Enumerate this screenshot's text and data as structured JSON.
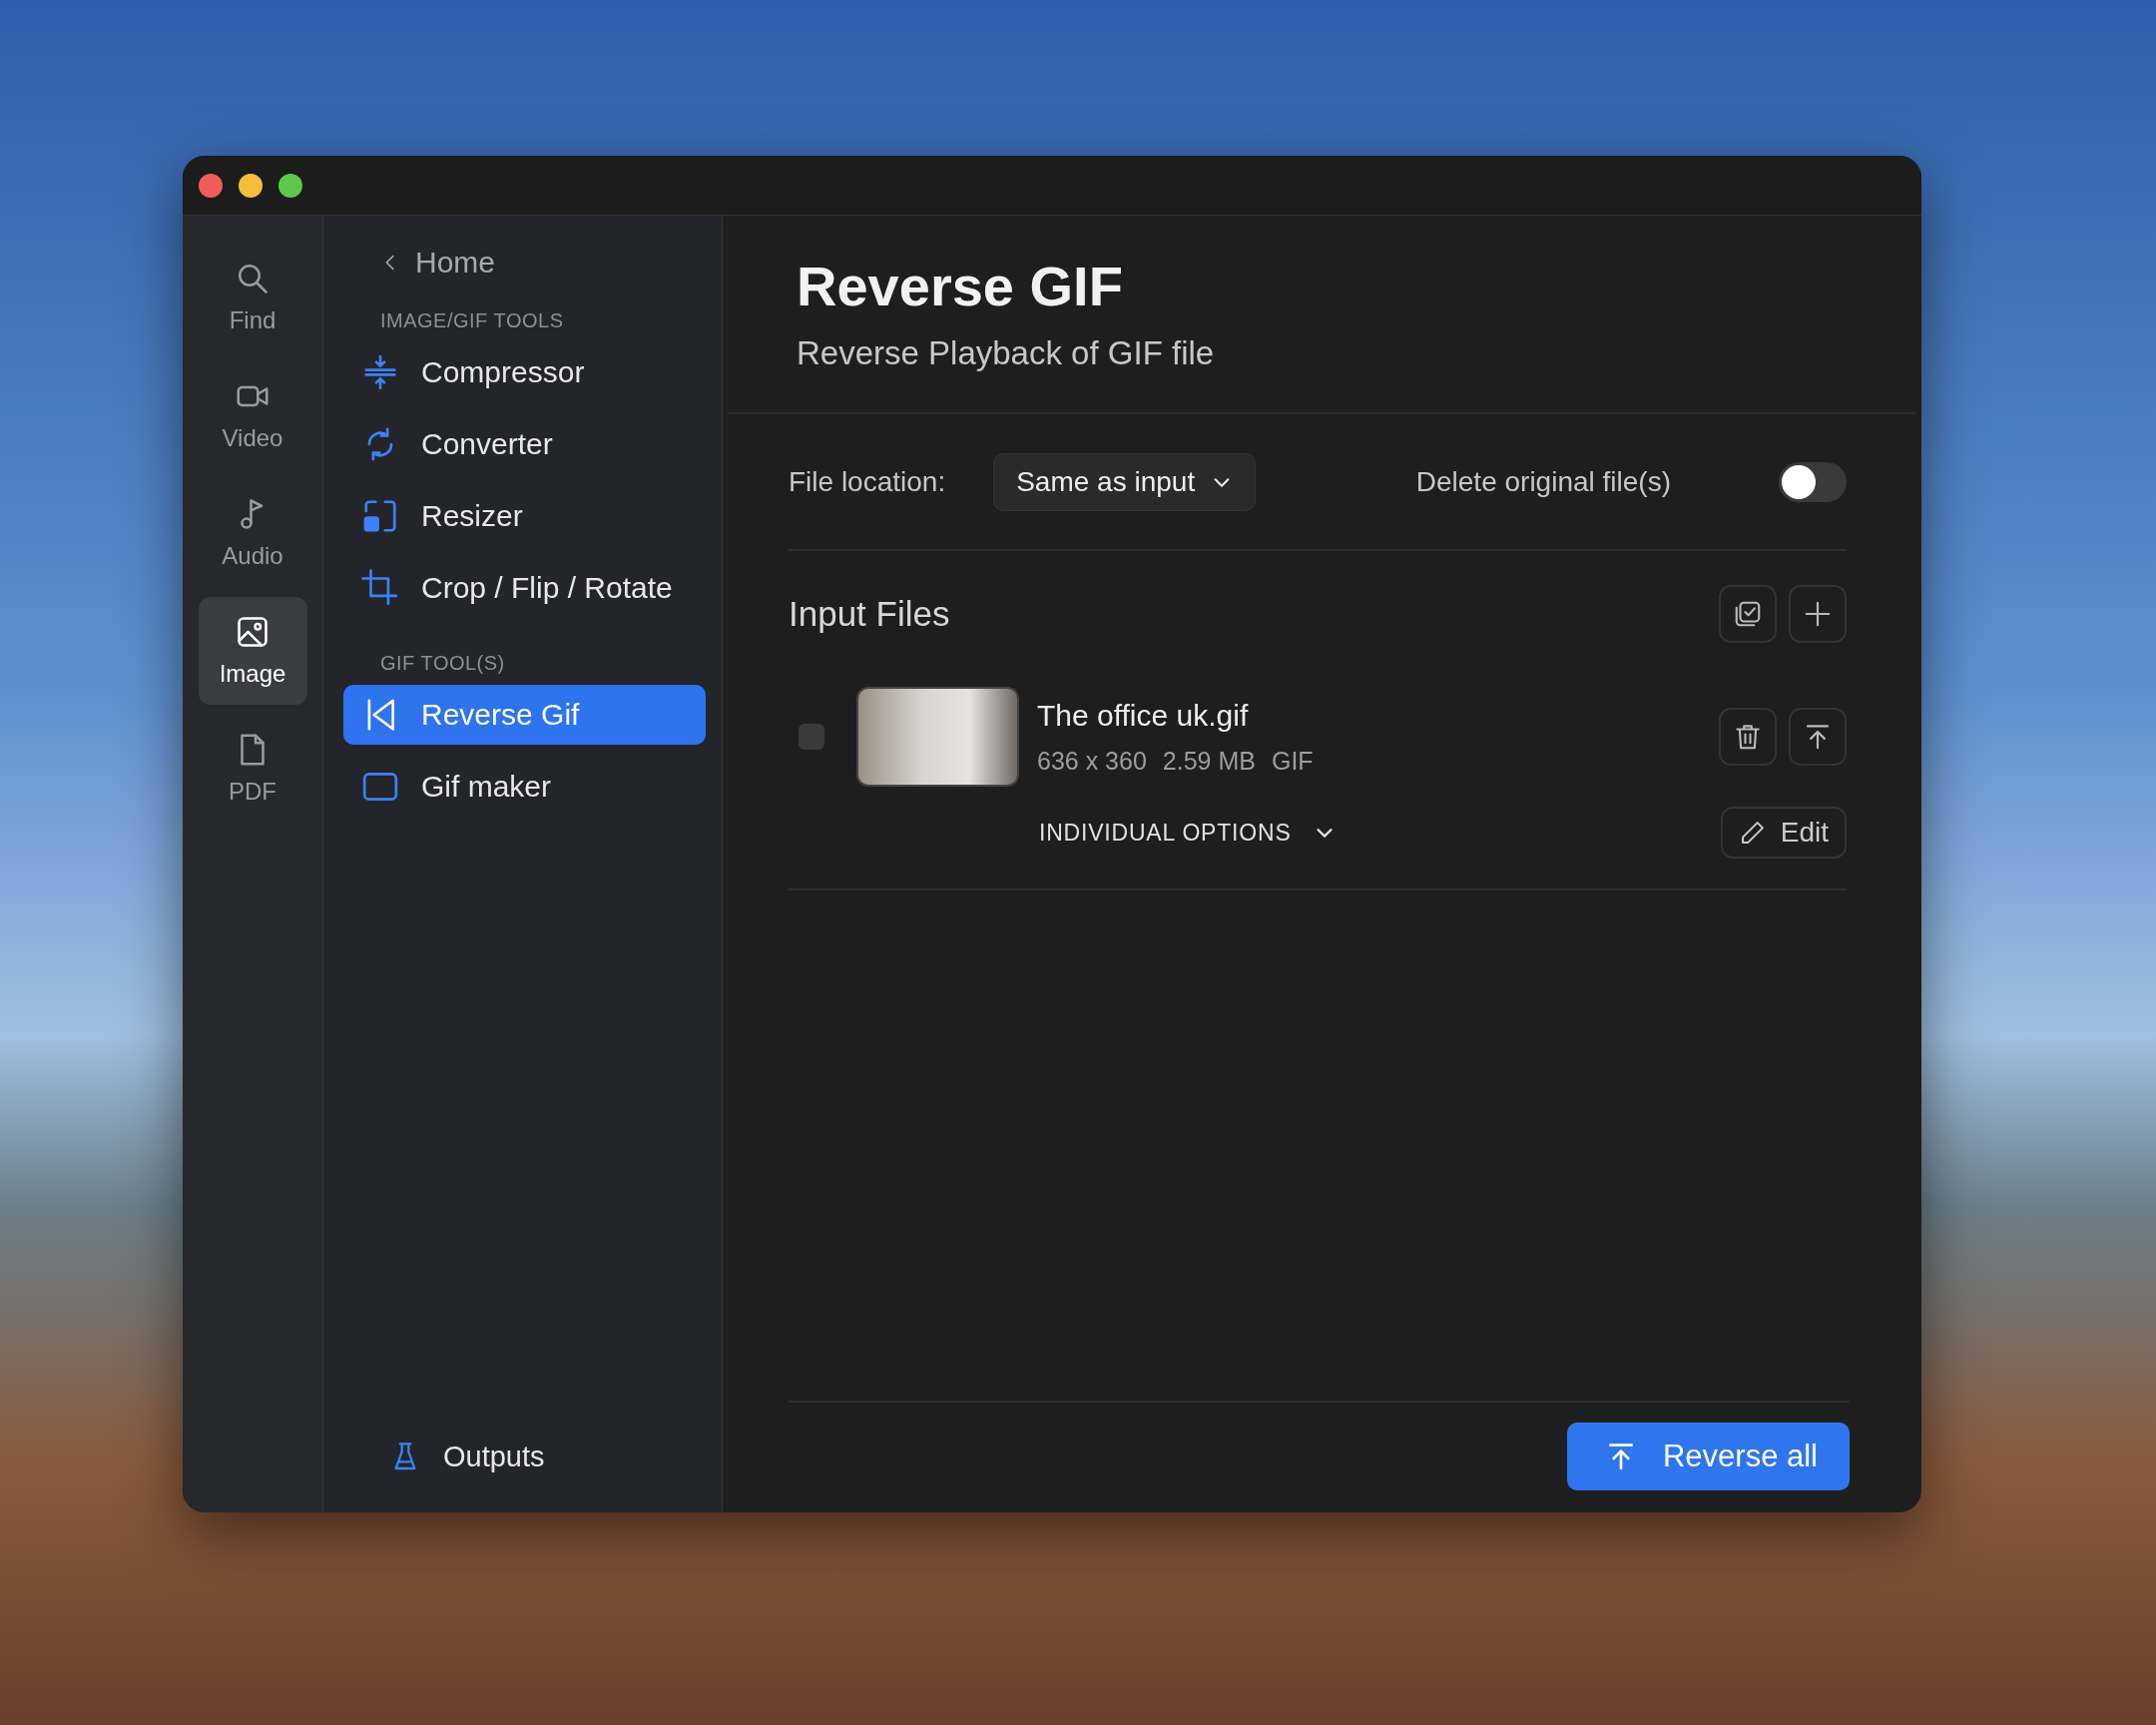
{
  "rail": [
    {
      "label": "Find",
      "kind": "find",
      "selected": false
    },
    {
      "label": "Video",
      "kind": "video",
      "selected": false
    },
    {
      "label": "Audio",
      "kind": "audio",
      "selected": false
    },
    {
      "label": "Image",
      "kind": "image",
      "selected": true
    },
    {
      "label": "PDF",
      "kind": "pdf",
      "selected": false
    }
  ],
  "nav": {
    "back": "Home",
    "sections": [
      {
        "heading": "IMAGE/GIF TOOLS",
        "items": [
          {
            "label": "Compressor",
            "kind": "compress",
            "selected": false
          },
          {
            "label": "Converter",
            "kind": "convert",
            "selected": false
          },
          {
            "label": "Resizer",
            "kind": "resize",
            "selected": false
          },
          {
            "label": "Crop / Flip / Rotate",
            "kind": "crop",
            "selected": false
          }
        ]
      },
      {
        "heading": "GIF TOOL(S)",
        "items": [
          {
            "label": "Reverse Gif",
            "kind": "reverse",
            "selected": true
          },
          {
            "label": "Gif maker",
            "kind": "gif",
            "selected": false
          }
        ]
      }
    ],
    "footer": "Outputs"
  },
  "main": {
    "title": "Reverse GIF",
    "subtitle": "Reverse Playback of GIF file",
    "file_location": {
      "label": "File location:",
      "value": "Same as input"
    },
    "delete_original": {
      "label": "Delete original file(s)",
      "on": false
    },
    "input_files": {
      "heading": "Input Files",
      "files": [
        {
          "name": "The office uk.gif",
          "details": [
            "636 x 360",
            "2.59 MB",
            "GIF"
          ],
          "checked": false,
          "options_label": "INDIVIDUAL OPTIONS",
          "expanded": false,
          "edit": "Edit"
        }
      ]
    },
    "action": "Reverse all"
  }
}
